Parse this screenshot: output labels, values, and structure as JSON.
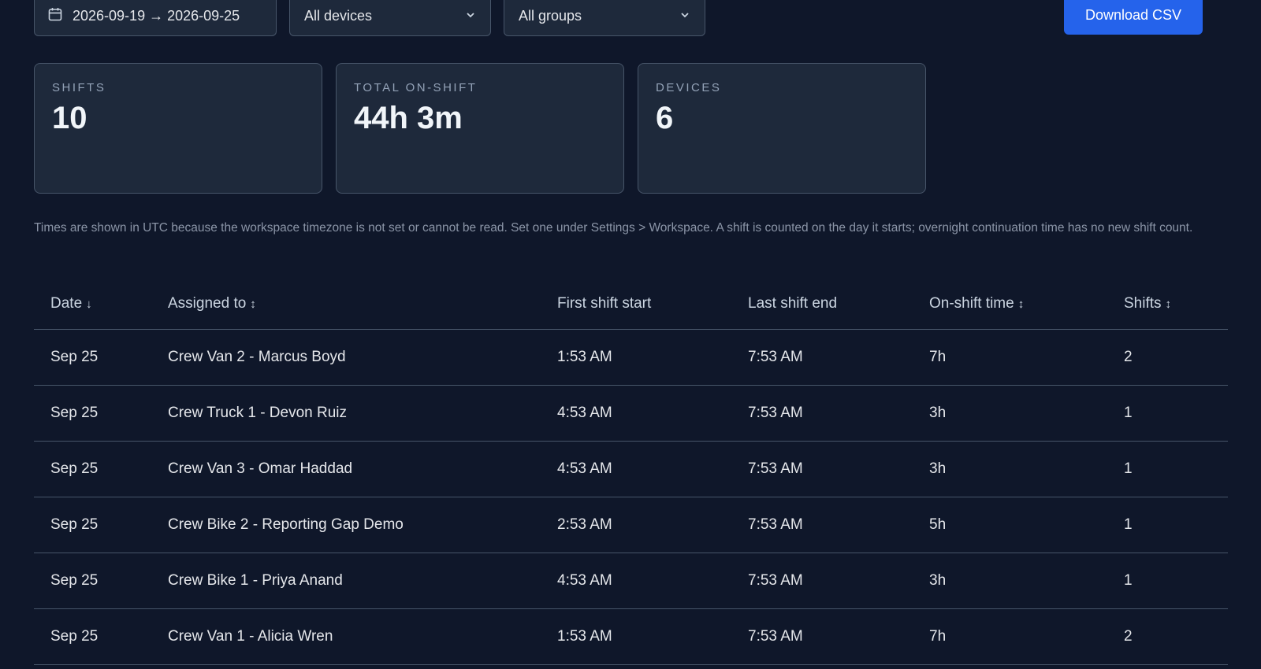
{
  "filters": {
    "date_range": "2026-09-19 → 2026-09-25",
    "device_select": "All devices",
    "group_select": "All groups",
    "download_label": "Download CSV"
  },
  "stats": [
    {
      "label": "SHIFTS",
      "value": "10"
    },
    {
      "label": "TOTAL ON-SHIFT",
      "value": "44h 3m"
    },
    {
      "label": "DEVICES",
      "value": "6"
    }
  ],
  "note": "Times are shown in UTC because the workspace timezone is not set or cannot be read. Set one under Settings > Workspace. A shift is counted on the day it starts; overnight continuation time has no new shift count.",
  "table": {
    "headers": [
      {
        "label": "Date",
        "sort": "↓"
      },
      {
        "label": "Assigned to",
        "sort": "↕"
      },
      {
        "label": "First shift start",
        "sort": ""
      },
      {
        "label": "Last shift end",
        "sort": ""
      },
      {
        "label": "On-shift time",
        "sort": "↕"
      },
      {
        "label": "Shifts",
        "sort": "↕"
      }
    ],
    "rows": [
      [
        "Sep 25",
        "Crew Van 2 - Marcus Boyd",
        "1:53 AM",
        "7:53 AM",
        "7h",
        "2"
      ],
      [
        "Sep 25",
        "Crew Truck 1 - Devon Ruiz",
        "4:53 AM",
        "7:53 AM",
        "3h",
        "1"
      ],
      [
        "Sep 25",
        "Crew Van 3 - Omar Haddad",
        "4:53 AM",
        "7:53 AM",
        "3h",
        "1"
      ],
      [
        "Sep 25",
        "Crew Bike 2 - Reporting Gap Demo",
        "2:53 AM",
        "7:53 AM",
        "5h",
        "1"
      ],
      [
        "Sep 25",
        "Crew Bike 1 - Priya Anand",
        "4:53 AM",
        "7:53 AM",
        "3h",
        "1"
      ],
      [
        "Sep 25",
        "Crew Van 1 - Alicia Wren",
        "1:53 AM",
        "7:53 AM",
        "7h",
        "2"
      ]
    ]
  }
}
